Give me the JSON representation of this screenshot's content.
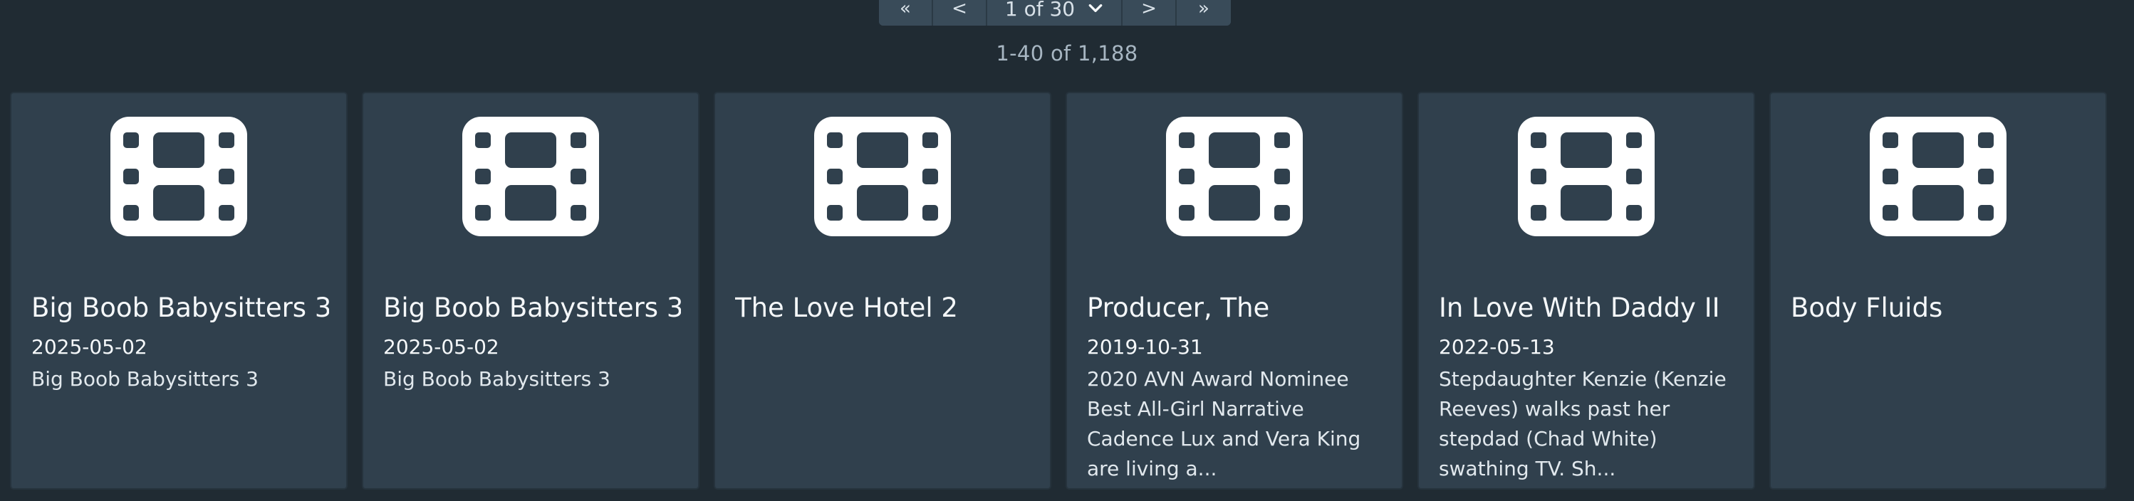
{
  "pagination": {
    "first_label": "«",
    "prev_label": "<",
    "page_select_label": "1 of 30",
    "next_label": ">",
    "last_label": "»"
  },
  "results": {
    "count_label": "1-40 of 1,188"
  },
  "cards": [
    {
      "title": "Big Boob Babysitters 3",
      "date": "2025-05-02",
      "description": "Big Boob Babysitters 3",
      "icon": "film-icon"
    },
    {
      "title": "Big Boob Babysitters 3",
      "date": "2025-05-02",
      "description": "Big Boob Babysitters 3",
      "icon": "film-icon"
    },
    {
      "title": "The Love Hotel 2",
      "date": "",
      "description": "",
      "icon": "film-icon"
    },
    {
      "title": "Producer, The",
      "date": "2019-10-31",
      "description": "2020 AVN Award Nominee Best All-Girl Narrative Cadence Lux and Vera King are living a...",
      "icon": "film-icon"
    },
    {
      "title": "In Love With Daddy II",
      "date": "2022-05-13",
      "description": "Stepdaughter Kenzie (Kenzie Reeves) walks past her stepdad (Chad White) swathing TV. Sh...",
      "icon": "film-icon"
    },
    {
      "title": "Body Fluids",
      "date": "",
      "description": "",
      "icon": "film-icon"
    }
  ],
  "colors": {
    "background": "#202b33",
    "card": "#30404d",
    "pager": "#394b59",
    "text": "#f5f8fa",
    "muted": "#a7b6c2"
  }
}
